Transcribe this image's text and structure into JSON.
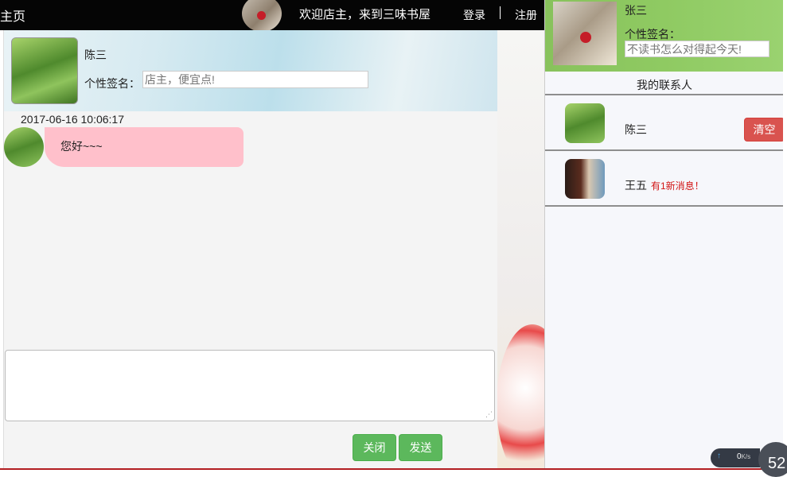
{
  "topbar": {
    "home_label": "主页",
    "welcome": "欢迎店主，来到三味书屋",
    "login": "登录",
    "register": "注册"
  },
  "chat": {
    "partner_name": "陈三",
    "signature_label": "个性签名：",
    "signature_placeholder": "店主，便宜点!",
    "messages": [
      {
        "timestamp": "2017-06-16 10:06:17",
        "text": "您好~~~"
      }
    ],
    "compose_value": "",
    "close_button": "关闭",
    "send_button": "发送"
  },
  "profile": {
    "name": "张三",
    "signature_label": "个性签名：",
    "signature_placeholder": "不读书怎么对得起今天!"
  },
  "contacts": {
    "title": "我的联系人",
    "items": [
      {
        "name": "陈三",
        "action": "清空"
      },
      {
        "name": "王五",
        "badge": "有1新消息！"
      }
    ]
  },
  "tray": {
    "net_speed": "0",
    "net_unit": "K/s",
    "dial_value": "52"
  },
  "colors": {
    "bubble": "#ffc0cb",
    "green_button": "#5cb85c",
    "red_button": "#d9534f",
    "profile_header": "#8cc85e",
    "new_message": "#d21414"
  }
}
